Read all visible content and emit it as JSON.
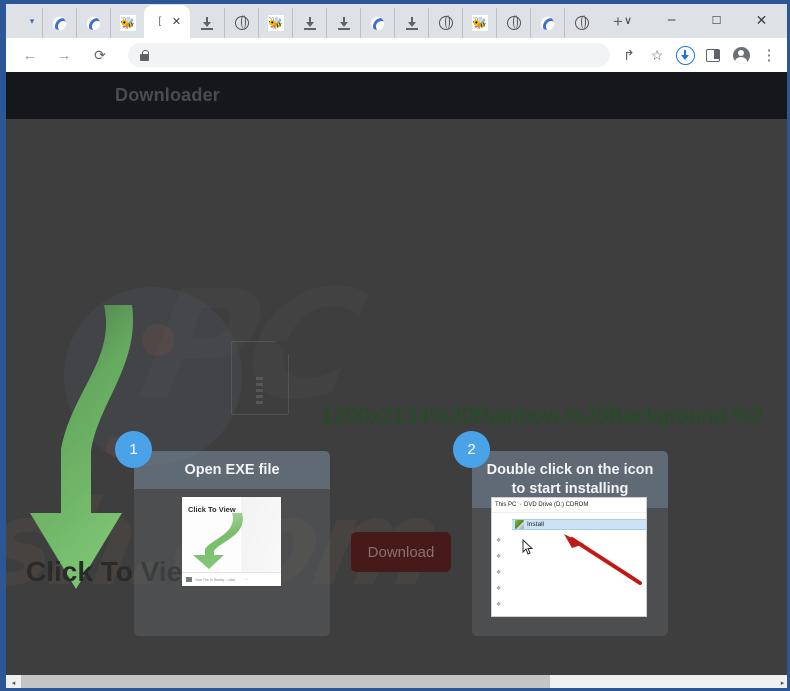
{
  "browser": {
    "tabs": [
      {
        "favicon": "chrome-icon",
        "active": false
      },
      {
        "favicon": "chrome-icon",
        "active": false
      },
      {
        "favicon": "bug-icon",
        "active": false
      },
      {
        "favicon": "blank-icon",
        "active": true
      },
      {
        "favicon": "download-icon",
        "active": false
      },
      {
        "favicon": "globe-icon",
        "active": false
      },
      {
        "favicon": "bug-icon",
        "active": false
      },
      {
        "favicon": "download-icon",
        "active": false
      },
      {
        "favicon": "download-icon",
        "active": false
      },
      {
        "favicon": "chrome-icon",
        "active": false
      },
      {
        "favicon": "download-icon",
        "active": false
      },
      {
        "favicon": "globe-icon",
        "active": false
      },
      {
        "favicon": "bug-icon",
        "active": false
      },
      {
        "favicon": "globe-icon",
        "active": false
      },
      {
        "favicon": "chrome-icon",
        "active": false
      },
      {
        "favicon": "globe-icon",
        "active": false
      }
    ],
    "new_tab_label": "+",
    "tab_close_label": "✕",
    "window_controls": {
      "tab_search": "∨",
      "minimize": "─",
      "maximize": "☐",
      "close": "✕"
    },
    "toolbar": {
      "back": "←",
      "forward": "→",
      "reload": "⟳",
      "lock": "lock-icon",
      "address_value": "",
      "address_placeholder": "",
      "share": "↱",
      "bookmark": "☆",
      "downloads": "download-circle-icon",
      "side_panel": "side-panel-icon",
      "profile": "profile-icon",
      "menu": "⋮"
    }
  },
  "page": {
    "brand": "Downloader",
    "watermark": "sh.com",
    "watermark_secondary": "PC",
    "filename": "1200x2134%20Rainbow.%20Background.%2",
    "big_cta": "Click To View",
    "download_button": "Download",
    "steps": [
      {
        "number": "1",
        "title": "Open EXE file",
        "shot": {
          "label": "Click To View",
          "statusbar_text": "Your File Is Ready – click",
          "statusbar_dots": "⋯"
        }
      },
      {
        "number": "2",
        "title": "Double click on the icon to start installing",
        "shot": {
          "breadcrumb_root": "This PC",
          "breadcrumb_sep": "›",
          "breadcrumb_drive": "DVD Drive (D:) CDROM",
          "file_name": "Install"
        }
      }
    ]
  },
  "scrollbar": {
    "left_arrow": "◂",
    "right_arrow": "▸"
  },
  "colors": {
    "window_frame": "#2b5797",
    "tabstrip": "#dee1e6",
    "page_bg": "#3e3e3e",
    "page_header": "#15171a",
    "filename_green": "#1f5120",
    "badge_blue": "#4aa3e8",
    "card_head": "rgba(125,145,166,0.42)",
    "download_btn": "#471a1a"
  }
}
